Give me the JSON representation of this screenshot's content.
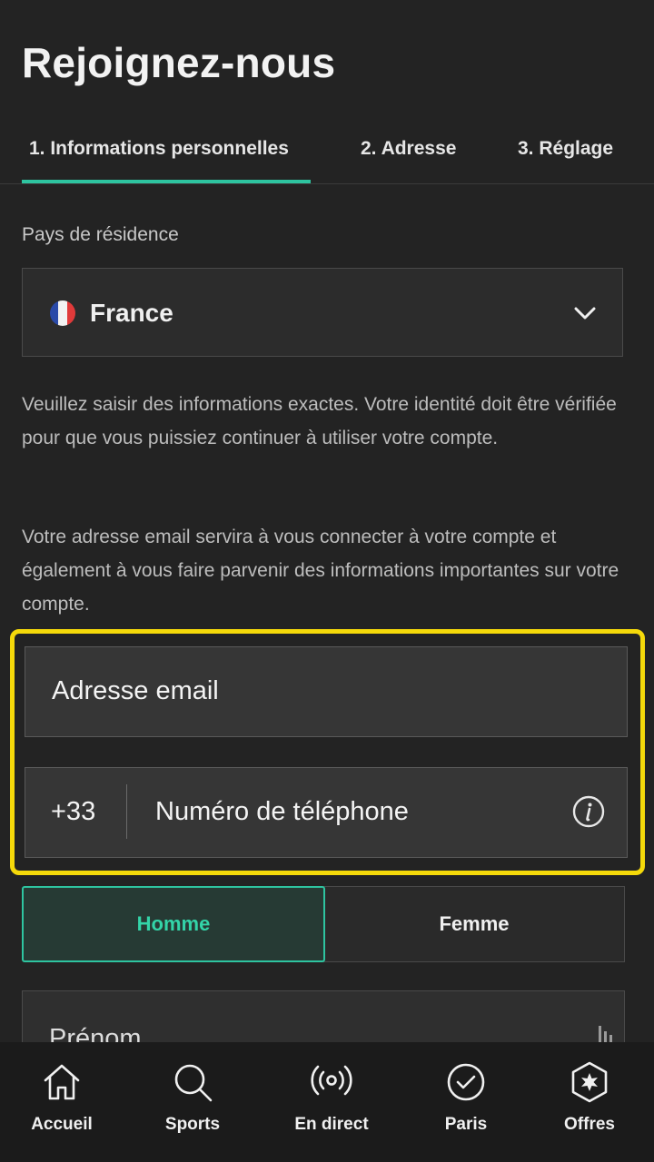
{
  "page": {
    "title": "Rejoignez-nous"
  },
  "tabs": [
    {
      "label": "1. Informations personnelles",
      "active": true
    },
    {
      "label": "2. Adresse",
      "active": false
    },
    {
      "label": "3. Réglage",
      "active": false
    }
  ],
  "country": {
    "label": "Pays de résidence",
    "value": "France",
    "flag_colors": [
      "#2a4aa8",
      "#f2f2f2",
      "#e03a3a"
    ]
  },
  "info": {
    "paragraph1": "Veuillez saisir des informations exactes. Votre identité doit être vérifiée pour que vous puissiez continuer à utiliser votre compte.",
    "paragraph2": "Votre adresse email servira à vous connecter à votre compte et également à vous faire parvenir des informations importantes sur votre compte."
  },
  "form": {
    "email_placeholder": "Adresse email",
    "phone_prefix": "+33",
    "phone_placeholder": "Numéro de téléphone",
    "gender_male": "Homme",
    "gender_female": "Femme",
    "gender_selected": "Homme",
    "firstname_placeholder": "Prénom"
  },
  "colors": {
    "accent": "#2ec4a0",
    "highlight": "#f5d90a",
    "background": "#232323"
  },
  "nav": [
    {
      "label": "Accueil",
      "icon": "home-icon"
    },
    {
      "label": "Sports",
      "icon": "search-icon"
    },
    {
      "label": "En direct",
      "icon": "live-broadcast-icon"
    },
    {
      "label": "Paris",
      "icon": "check-circle-icon"
    },
    {
      "label": "Offres",
      "icon": "offer-badge-icon"
    }
  ]
}
